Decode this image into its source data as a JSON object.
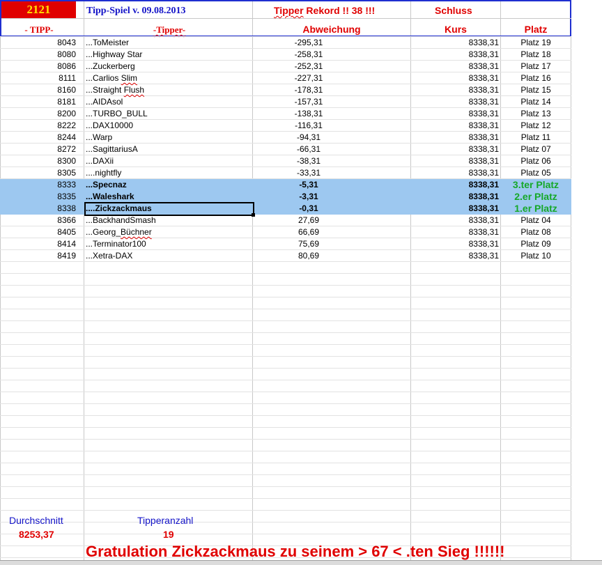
{
  "header": {
    "number": "2121",
    "title": "Tipp-Spiel v. 09.08.2013",
    "record": "Tipper Rekord !!  38  !!!",
    "schluss": "Schluss",
    "col_tipp": "- TIPP-",
    "col_tipper": "-Tipper-",
    "col_abw": "Abweichung",
    "col_kurs": "Kurs",
    "col_platz": "Platz"
  },
  "rows": [
    {
      "tipp": "8043",
      "name": "...ToMeister",
      "abw": "-295,31",
      "kurs": "8338,31",
      "platz": "Platz 19"
    },
    {
      "tipp": "8080",
      "name": "...Highway Star",
      "abw": "-258,31",
      "kurs": "8338,31",
      "platz": "Platz 18"
    },
    {
      "tipp": "8086",
      "name": "...Zuckerberg",
      "abw": "-252,31",
      "kurs": "8338,31",
      "platz": "Platz 17"
    },
    {
      "tipp": "8111",
      "name": "...Carlios Slim",
      "abw": "-227,31",
      "kurs": "8338,31",
      "platz": "Platz 16"
    },
    {
      "tipp": "8160",
      "name": "...Straight Flush",
      "abw": "-178,31",
      "kurs": "8338,31",
      "platz": "Platz 15"
    },
    {
      "tipp": "8181",
      "name": "...AIDAsol",
      "abw": "-157,31",
      "kurs": "8338,31",
      "platz": "Platz 14"
    },
    {
      "tipp": "8200",
      "name": "...TURBO_BULL",
      "abw": "-138,31",
      "kurs": "8338,31",
      "platz": "Platz 13"
    },
    {
      "tipp": "8222",
      "name": "...DAX10000",
      "abw": "-116,31",
      "kurs": "8338,31",
      "platz": "Platz 12"
    },
    {
      "tipp": "8244",
      "name": "...Warp",
      "abw": "-94,31",
      "kurs": "8338,31",
      "platz": "Platz 11"
    },
    {
      "tipp": "8272",
      "name": "...SagittariusA",
      "abw": "-66,31",
      "kurs": "8338,31",
      "platz": "Platz 07"
    },
    {
      "tipp": "8300",
      "name": "...DAXii",
      "abw": "-38,31",
      "kurs": "8338,31",
      "platz": "Platz 06"
    },
    {
      "tipp": "8305",
      "name": "....nightfly",
      "abw": "-33,31",
      "kurs": "8338,31",
      "platz": "Platz 05"
    },
    {
      "tipp": "8333",
      "name": "...Specnaz",
      "abw": "-5,31",
      "kurs": "8338,31",
      "platz": "3.ter Platz",
      "highlight": true
    },
    {
      "tipp": "8335",
      "name": "...Waleshark",
      "abw": "-3,31",
      "kurs": "8338,31",
      "platz": "2.er Platz",
      "highlight": true
    },
    {
      "tipp": "8338",
      "name": "....Zickzackmaus",
      "abw": "-0,31",
      "kurs": "8338,31",
      "platz": "1.er Platz",
      "highlight": true
    },
    {
      "tipp": "8366",
      "name": "...BackhandSmash",
      "abw": "27,69",
      "kurs": "8338,31",
      "platz": "Platz 04"
    },
    {
      "tipp": "8405",
      "name": "...Georg_Büchner",
      "abw": "66,69",
      "kurs": "8338,31",
      "platz": "Platz 08"
    },
    {
      "tipp": "8414",
      "name": "...Terminator100",
      "abw": "75,69",
      "kurs": "8338,31",
      "platz": "Platz 09"
    },
    {
      "tipp": "8419",
      "name": "...Xetra-DAX",
      "abw": "80,69",
      "kurs": "8338,31",
      "platz": "Platz 10"
    }
  ],
  "footer": {
    "durchschnitt_label": "Durchschnitt",
    "durchschnitt_value": "8253,37",
    "tipperanzahl_label": "Tipperanzahl",
    "tipperanzahl_value": "19",
    "gratulation": "Gratulation Zickzackmaus zu seinem > 67 < .ten Sieg !!!!!!"
  },
  "colors": {
    "accent_red": "#e00000",
    "accent_blue": "#1414c8",
    "highlight_bg": "#9dc8f0",
    "winner_green": "#15a828"
  }
}
